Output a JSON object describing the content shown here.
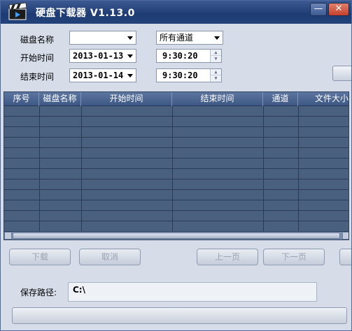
{
  "window": {
    "title": "硬盘下载器  V1.13.0",
    "minimize_label": "—",
    "close_label": "✕"
  },
  "form": {
    "disk_label": "磁盘名称",
    "disk_value": "",
    "channel_value": "所有通道",
    "start_label": "开始时间",
    "start_date": "2013-01-13",
    "start_time": "9:30:20",
    "end_label": "结束时间",
    "end_date": "2013-01-14",
    "end_time": "9:30:20"
  },
  "table": {
    "columns": [
      "序号",
      "磁盘名称",
      "开始时间",
      "结束时间",
      "通道",
      "文件大小"
    ],
    "rows": []
  },
  "buttons": {
    "download": "下载",
    "cancel": "取消",
    "prev_page": "上一页",
    "next_page": "下一页"
  },
  "save": {
    "label": "保存路径:",
    "path": "C:\\"
  },
  "progress": {
    "value": 0
  },
  "icons": {
    "app": "clapperboard-icon",
    "dropdown": "chevron-down-icon",
    "spin_up": "spin-up-icon",
    "spin_down": "spin-down-icon"
  },
  "colors": {
    "titlebar": "#22427a",
    "table_bg": "#49607f",
    "window_bg": "#d6dde8"
  }
}
